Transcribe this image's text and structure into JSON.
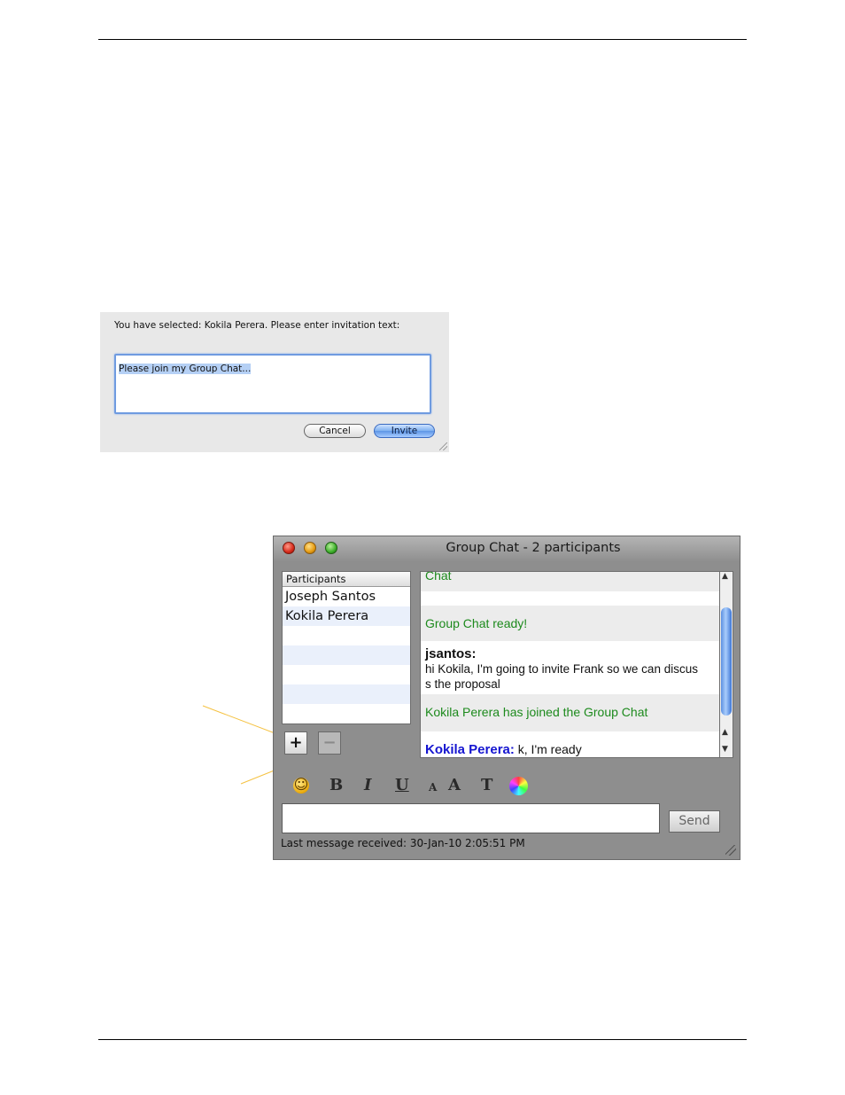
{
  "invite_dialog": {
    "prompt": "You have selected: Kokila Perera. Please enter invitation text:",
    "invitation_text": "Please join my Group Chat...",
    "cancel_label": "Cancel",
    "invite_label": "Invite"
  },
  "chat_window": {
    "title": "Group Chat - 2 participants",
    "participants_header": "Participants",
    "participants": [
      "Joseph Santos",
      "Kokila Perera"
    ],
    "add_label": "+",
    "remove_label": "−",
    "messages": {
      "partial": "Chat",
      "ready": "Group Chat ready!",
      "sender": "jsantos:",
      "body_line1": "hi Kokila, I'm going to invite Frank so we can discus",
      "body_line2": "s the proposal",
      "joined": "Kokila Perera has joined the Group Chat",
      "last_name": "Kokila Perera:",
      "last_text": " k, I'm ready"
    },
    "toolbar": {
      "bold": "B",
      "italic": "I",
      "underline": "U",
      "smaller": "A",
      "larger": "A",
      "font": "T"
    },
    "send_label": "Send",
    "status": "Last message received: 30-Jan-10 2:05:51 PM"
  },
  "colors": {
    "system_message": "#1d8a1d",
    "user_name": "#1515d0",
    "callout_line": "#f5c242"
  }
}
